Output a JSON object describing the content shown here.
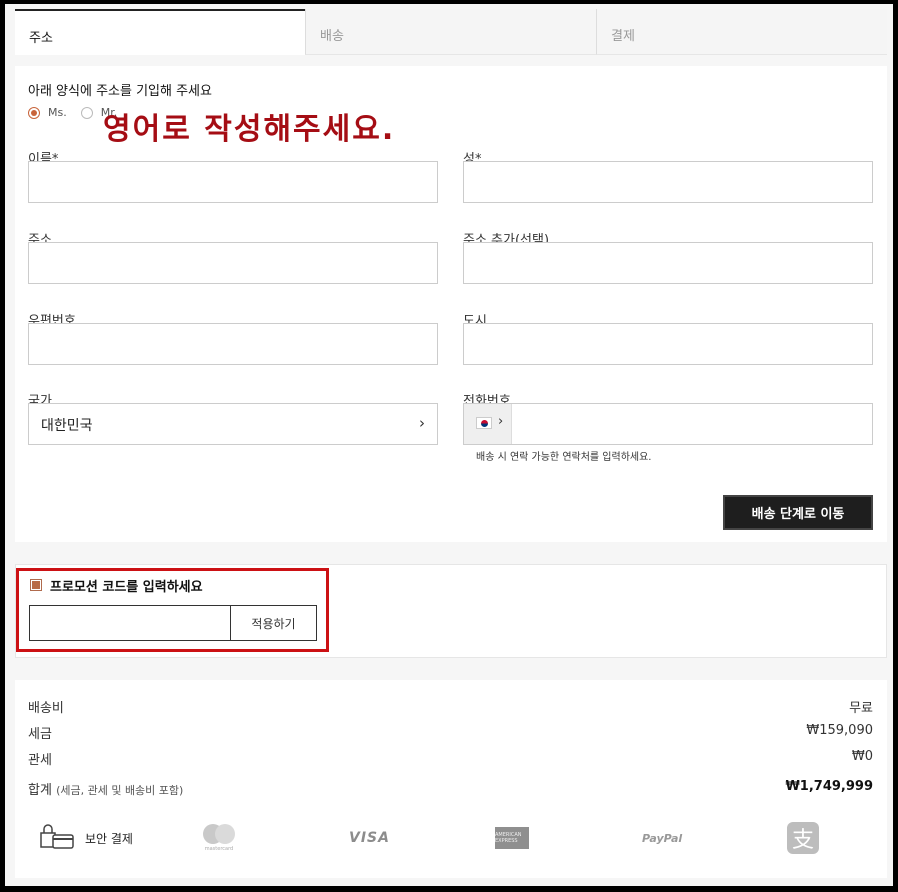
{
  "tabs": [
    {
      "label": "주소",
      "active": true
    },
    {
      "label": "배송",
      "active": false
    },
    {
      "label": "결제",
      "active": false
    }
  ],
  "form": {
    "title": "아래 양식에 주소를 기입해 주세요",
    "radio_ms": "Ms.",
    "radio_mr": "Mr.",
    "note": "영어로 작성해주세요.",
    "first_name_label": "이름*",
    "last_name_label": "성*",
    "address_label": "주소",
    "address2_label": "주소 추가(선택)",
    "postcode_label": "우편번호",
    "city_label": "도시",
    "country_label": "국가",
    "country_value": "대한민국",
    "phone_label": "전화번호",
    "phone_hint": "배송 시 연락 가능한 연락처를 입력하세요.",
    "next_button": "배송 단계로 이동"
  },
  "promo": {
    "label": "프로모션 코드를 입력하세요",
    "apply_button": "적용하기"
  },
  "summary": {
    "shipping_label": "배송비",
    "shipping_value": "무료",
    "tax_label": "세금",
    "tax_value": "₩159,090",
    "duty_label": "관세",
    "duty_value": "₩0",
    "total_label": "합계",
    "total_sub": "(세금, 관세 및 배송비 포함)",
    "total_value": "₩1,749,999",
    "secure_label": "보안 결제",
    "mastercard_label": "mastercard",
    "visa_label": "VISA",
    "amex_label": "AMERICAN EXPRESS",
    "paypal_label": "PayPal",
    "alipay_glyph": "支"
  },
  "colors": {
    "accent": "#c8643b",
    "note_red": "#a50d14",
    "highlight_red": "#cc1114",
    "button_dark": "#1e1e1e"
  }
}
